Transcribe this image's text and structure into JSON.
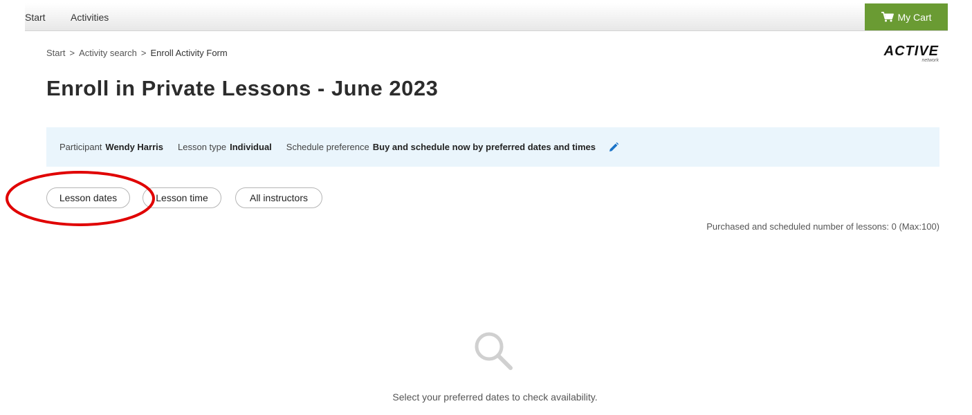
{
  "nav": {
    "start_label": "Start",
    "activities_label": "Activities",
    "cart_label": "My Cart",
    "cart_icon": "shopping-cart-icon"
  },
  "breadcrumb": {
    "items": [
      "Start",
      "Activity search",
      "Enroll Activity Form"
    ],
    "separator": ">"
  },
  "logo": {
    "main": "ACTIVE",
    "sub": "network"
  },
  "page": {
    "title": "Enroll in Private Lessons - June 2023"
  },
  "summary": {
    "participant_label": "Participant",
    "participant_value": "Wendy Harris",
    "lesson_type_label": "Lesson type",
    "lesson_type_value": "Individual",
    "schedule_label": "Schedule preference",
    "schedule_value": "Buy and schedule now by preferred dates and times",
    "edit_icon": "pencil-icon"
  },
  "filters": {
    "lesson_dates": "Lesson dates",
    "lesson_time": "Lesson time",
    "instructors": "All instructors"
  },
  "status": {
    "lesson_count_text": "Purchased and scheduled number of lessons: 0 (Max:100)"
  },
  "empty_state": {
    "icon": "search-icon",
    "message": "Select your preferred dates to check availability."
  },
  "colors": {
    "cart_green": "#6a9b33",
    "summary_bg": "#eaf5fc",
    "edit_blue": "#1a73c8",
    "annotation_red": "#e00000"
  }
}
